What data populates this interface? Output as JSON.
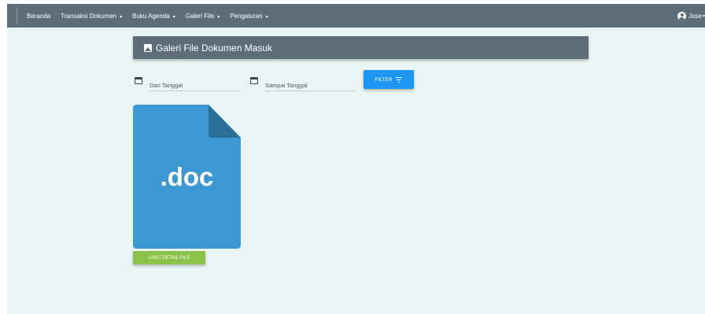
{
  "navbar": {
    "items": [
      {
        "label": "Beranda",
        "dropdown": false
      },
      {
        "label": "Transaksi Dokumen",
        "dropdown": true
      },
      {
        "label": "Buku Agenda",
        "dropdown": true
      },
      {
        "label": "Galeri File",
        "dropdown": true
      },
      {
        "label": "Pengaturan",
        "dropdown": true
      }
    ],
    "caret": "▾",
    "user": {
      "name": "Jose",
      "icon": "account-circle-icon"
    }
  },
  "header": {
    "title": "Galeri File Dokumen Masuk",
    "icon": "image-icon"
  },
  "filters": {
    "from": {
      "placeholder": "Dari Tanggal",
      "value": "",
      "icon": "calendar-icon"
    },
    "to": {
      "placeholder": "Sampai Tanggal",
      "value": "",
      "icon": "calendar-icon"
    },
    "button": {
      "label": "FILTER",
      "icon": "filter-icon"
    }
  },
  "gallery": {
    "files": [
      {
        "ext_label": ".doc",
        "button_label": "LIHAT DETAIL FILE",
        "icon": "doc-file-icon"
      }
    ]
  },
  "colors": {
    "navbar": "#5d6e79",
    "background": "#e8f5f4",
    "file_icon": "#3d97d3",
    "file_fold": "#2a6f99",
    "filter_button": "#1e96f3",
    "detail_button": "#8bc34a"
  }
}
